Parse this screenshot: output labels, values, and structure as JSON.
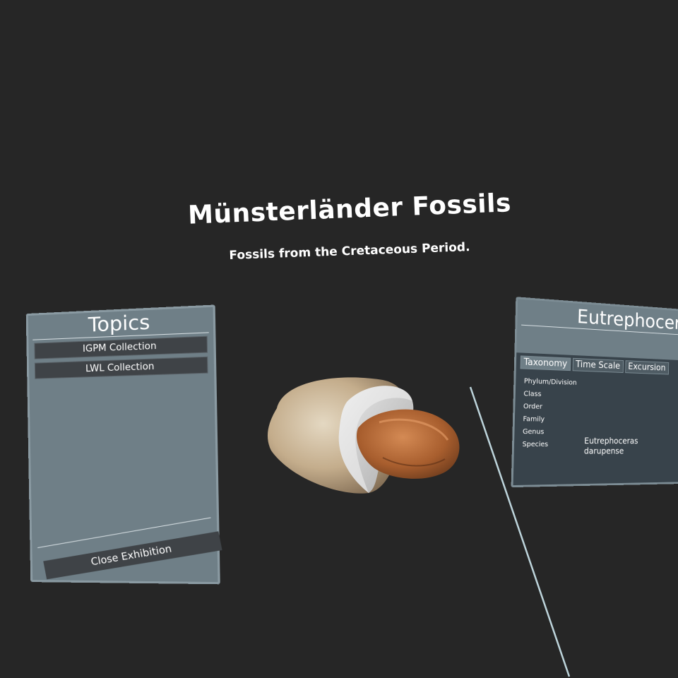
{
  "exhibition": {
    "title": "Münsterländer Fossils",
    "subtitle": "Fossils from the Cretaceous Period."
  },
  "topics_panel": {
    "title": "Topics",
    "items": [
      {
        "label": "IGPM Collection"
      },
      {
        "label": "LWL Collection"
      }
    ],
    "close_label": "Close Exhibition"
  },
  "info_panel": {
    "title": "Eutrephoceras darupense",
    "tabs": [
      {
        "label": "Taxonomy",
        "active": true
      },
      {
        "label": "Time Scale",
        "active": false
      },
      {
        "label": "Excursion",
        "active": false
      }
    ],
    "taxonomy": {
      "labels": [
        "Phylum/Division",
        "Class",
        "Order",
        "Family",
        "Genus",
        "Species"
      ],
      "species_value": "Eutrephoceras darupense"
    }
  },
  "colors": {
    "background": "#262626",
    "panel": "#6f7f87",
    "panel_dark": "#38434b",
    "button": "#3f4347",
    "ray": "#cfe8f0"
  }
}
